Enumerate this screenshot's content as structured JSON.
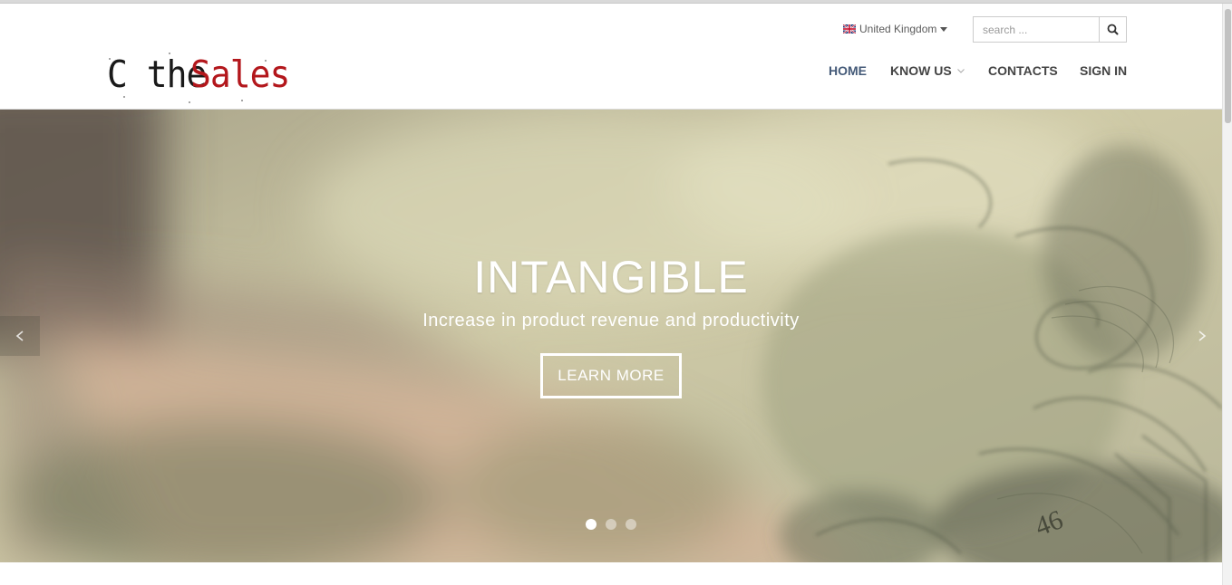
{
  "header": {
    "logo": {
      "word1": "C the",
      "word2": "Sales"
    },
    "country": {
      "label": "United Kingdom",
      "flag": "uk-flag-icon"
    },
    "search": {
      "placeholder": "search ...",
      "icon": "search-icon"
    },
    "nav": [
      {
        "label": "HOME",
        "active": true
      },
      {
        "label": "KNOW US",
        "has_dropdown": true
      },
      {
        "label": "CONTACTS"
      },
      {
        "label": "SIGN IN"
      }
    ]
  },
  "hero": {
    "title": "INTANGIBLE",
    "subtitle": "Increase in product revenue and productivity",
    "button": "LEARN MORE",
    "slide_count": 3,
    "active_slide": 1
  },
  "colors": {
    "brand_red": "#b3171c",
    "nav_active": "#445a78",
    "nav_text": "#444444"
  }
}
